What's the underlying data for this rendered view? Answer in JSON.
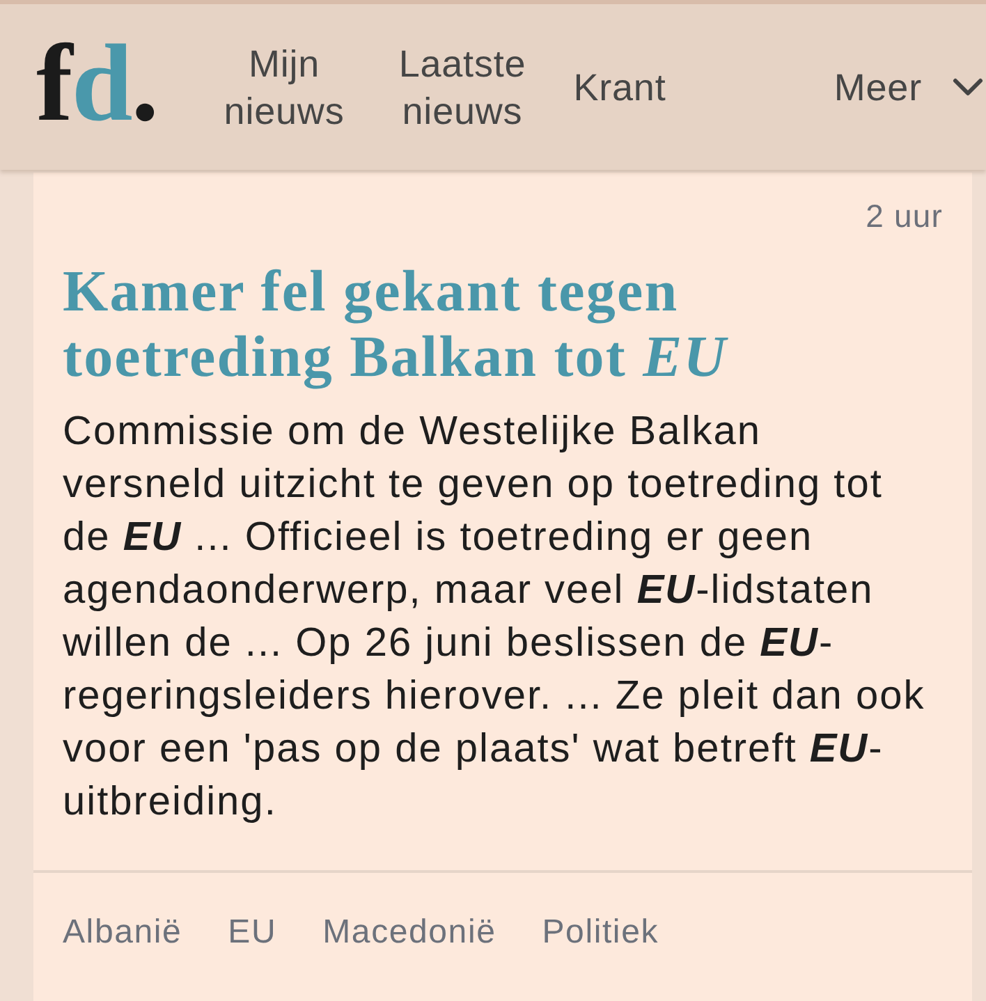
{
  "header": {
    "logo": "fd.",
    "nav": [
      {
        "label": "Mijn nieuws",
        "kind": "link"
      },
      {
        "label": "Laatste nieuws",
        "kind": "link"
      },
      {
        "label": "Krant",
        "kind": "link"
      },
      {
        "label": "Meer",
        "kind": "dropdown"
      }
    ]
  },
  "article": {
    "time": "2 uur",
    "title": "Kamer fel gekant tegen toetreding Balkan tot *EU*",
    "snippet": "Commissie om de Westelijke Balkan versneld uitzicht te geven op toetreding tot de **EU** ... Officieel is toetreding er geen agendaonderwerp, maar veel **EU**-lidstaten willen de ... Op 26 juni beslissen de **EU**-regeringsleiders hierover. ... Ze pleit dan ook voor een 'pas op de plaats' wat betreft **EU**-uitbreiding.",
    "tags": [
      "Albanië",
      "EU",
      "Macedonië",
      "Politiek"
    ]
  }
}
